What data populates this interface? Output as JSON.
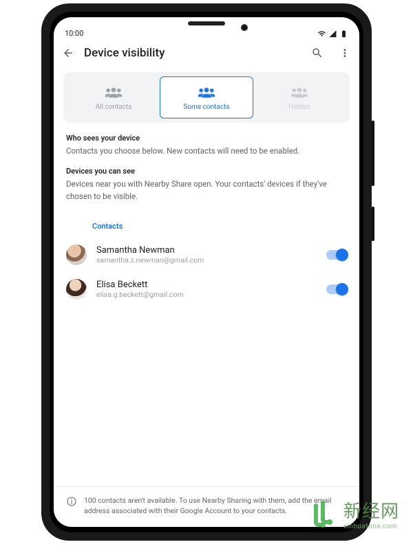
{
  "statusbar": {
    "time": "10:00"
  },
  "appbar": {
    "title": "Device visibility"
  },
  "tabs": [
    {
      "label": "All contacts",
      "state": "inactive"
    },
    {
      "label": "Some contacts",
      "state": "active"
    },
    {
      "label": "Hidden",
      "state": "faded"
    }
  ],
  "sections": [
    {
      "head": "Who sees your device",
      "body": "Contacts you choose below. New contacts will need to be enabled."
    },
    {
      "head": "Devices you can see",
      "body": "Devices near you with Nearby Share open. Your contacts' devices if they've chosen to be visible."
    }
  ],
  "contacts_header": "Contacts",
  "contacts": [
    {
      "name": "Samantha Newman",
      "email": "samantha.z.newman@gmail.com",
      "enabled": true
    },
    {
      "name": "Elisa Beckett",
      "email": "elisa.g.beckett@gmail.com",
      "enabled": true
    }
  ],
  "footer": "100 contacts aren't available. To use Nearby Sharing with them, add the email address associated with their Google Account to your contacts.",
  "watermark": {
    "name": "新经网",
    "url": "xinhuatone.com"
  }
}
